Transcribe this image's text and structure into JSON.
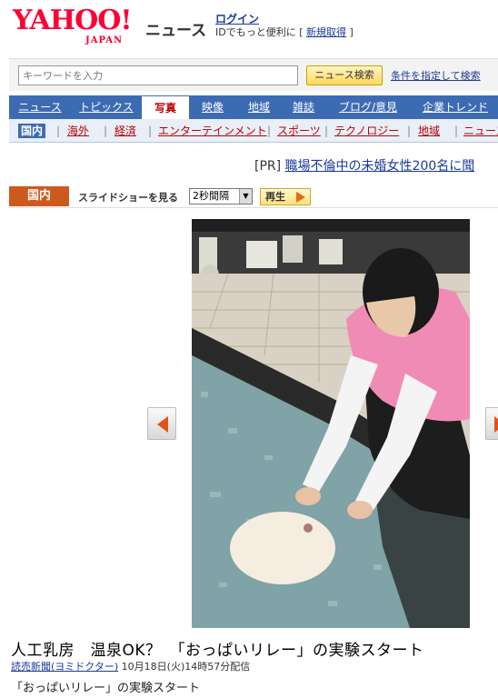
{
  "header": {
    "logo_text": "YAHOO!",
    "logo_sub": "JAPAN",
    "service_name": "ニュース",
    "login_label": "ログイン",
    "login_note": "IDでもっと便利に",
    "signup_label": "新規取得",
    "bracket_open": "[",
    "bracket_close": "]"
  },
  "search": {
    "placeholder": "キーワードを入力",
    "button_label": "ニュース検索",
    "advanced_label": "条件を指定して検索"
  },
  "nav": {
    "tabs": [
      {
        "label": "ニュース"
      },
      {
        "label": "トピックス"
      },
      {
        "label": "写真"
      },
      {
        "label": "映像"
      },
      {
        "label": "地域"
      },
      {
        "label": "雑誌"
      },
      {
        "label": "ブログ/意見"
      },
      {
        "label": "企業トレンド"
      }
    ],
    "active_tab": "写真"
  },
  "sub_nav": {
    "tabs": [
      {
        "label": "国内"
      },
      {
        "label": "海外"
      },
      {
        "label": "経済"
      },
      {
        "label": "エンターテインメント"
      },
      {
        "label": "スポーツ"
      },
      {
        "label": "テクノロジー"
      },
      {
        "label": "地域"
      },
      {
        "label": "ニュース"
      }
    ],
    "active_tab": "国内"
  },
  "pr": {
    "tag": "[PR]",
    "text": "職場不倫中の未婚女性200名に聞"
  },
  "slideshow": {
    "category": "国内",
    "label": "スライドショーを見る",
    "interval": "2秒間隔",
    "play_label": "再生"
  },
  "article": {
    "title": "人工乳房　温泉OK？　「おっぱいリレー」の実験スタート",
    "source": "読売新聞(ヨミドクター)",
    "datetime": "10月18日(火)14時57分配信",
    "caption": "「おっぱいリレー」の実験スタート"
  },
  "colors": {
    "yahoo_red": "#ff0033",
    "nav_blue": "#3d6bb3",
    "link_blue": "#1a3a99",
    "category_orange": "#cc5a1e",
    "arrow_orange": "#e2521a"
  },
  "icons": [
    "prev-arrow-icon",
    "next-arrow-icon",
    "play-triangle-icon",
    "select-arrow-icon"
  ]
}
